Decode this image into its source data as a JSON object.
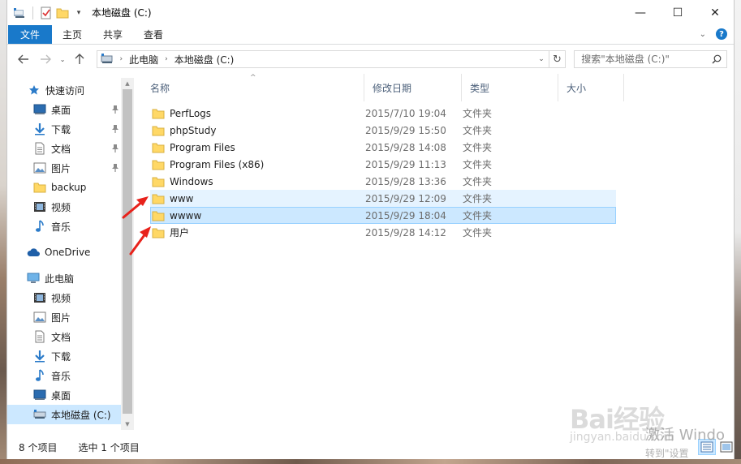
{
  "window": {
    "title": "本地磁盘 (C:)",
    "controls": {
      "minimize": "—",
      "maximize": "☐",
      "close": "✕"
    }
  },
  "ribbon": {
    "tabs": [
      "文件",
      "主页",
      "共享",
      "查看"
    ],
    "expand_icon": "chevron-down-icon",
    "help_label": "?"
  },
  "address": {
    "segments": [
      "此电脑",
      "本地磁盘 (C:)"
    ],
    "search_placeholder": "搜索\"本地磁盘 (C:)\""
  },
  "nav": {
    "quick_access": "快速访问",
    "quick_items": [
      {
        "label": "桌面",
        "icon": "desktop-icon",
        "pinned": true
      },
      {
        "label": "下载",
        "icon": "download-icon",
        "pinned": true
      },
      {
        "label": "文档",
        "icon": "document-icon",
        "pinned": true
      },
      {
        "label": "图片",
        "icon": "picture-icon",
        "pinned": true
      },
      {
        "label": "backup",
        "icon": "folder-icon",
        "pinned": false
      },
      {
        "label": "视频",
        "icon": "video-icon",
        "pinned": false
      },
      {
        "label": "音乐",
        "icon": "music-icon",
        "pinned": false
      }
    ],
    "onedrive": "OneDrive",
    "this_pc": "此电脑",
    "pc_items": [
      {
        "label": "视频",
        "icon": "video-icon"
      },
      {
        "label": "图片",
        "icon": "picture-icon"
      },
      {
        "label": "文档",
        "icon": "document-icon"
      },
      {
        "label": "下载",
        "icon": "download-icon"
      },
      {
        "label": "音乐",
        "icon": "music-icon"
      },
      {
        "label": "桌面",
        "icon": "desktop-icon"
      },
      {
        "label": "本地磁盘 (C:)",
        "icon": "drive-icon",
        "selected": true
      }
    ]
  },
  "columns": [
    "名称",
    "修改日期",
    "类型",
    "大小"
  ],
  "files": [
    {
      "name": "PerfLogs",
      "date": "2015/7/10 19:04",
      "type": "文件夹",
      "state": ""
    },
    {
      "name": "phpStudy",
      "date": "2015/9/29 15:50",
      "type": "文件夹",
      "state": ""
    },
    {
      "name": "Program Files",
      "date": "2015/9/28 14:08",
      "type": "文件夹",
      "state": ""
    },
    {
      "name": "Program Files (x86)",
      "date": "2015/9/29 11:13",
      "type": "文件夹",
      "state": ""
    },
    {
      "name": "Windows",
      "date": "2015/9/28 13:36",
      "type": "文件夹",
      "state": ""
    },
    {
      "name": "www",
      "date": "2015/9/29 12:09",
      "type": "文件夹",
      "state": "hover"
    },
    {
      "name": "wwww",
      "date": "2015/9/29 18:04",
      "type": "文件夹",
      "state": "sel"
    },
    {
      "name": "用户",
      "date": "2015/9/28 14:12",
      "type": "文件夹",
      "state": ""
    }
  ],
  "status": {
    "count": "8 个项目",
    "selected": "选中 1 个项目"
  },
  "watermark": {
    "brand": "Bai经验",
    "sub": "jingyan.baidu.com",
    "activate": "激活 Windo",
    "activate_sub": "转到\"设置"
  },
  "colors": {
    "accent": "#1979ca",
    "selection": "#cce8ff",
    "selection_border": "#99d1ff",
    "hover": "#e5f3ff",
    "folder": "#ffd866",
    "arrow": "#e8221b"
  }
}
